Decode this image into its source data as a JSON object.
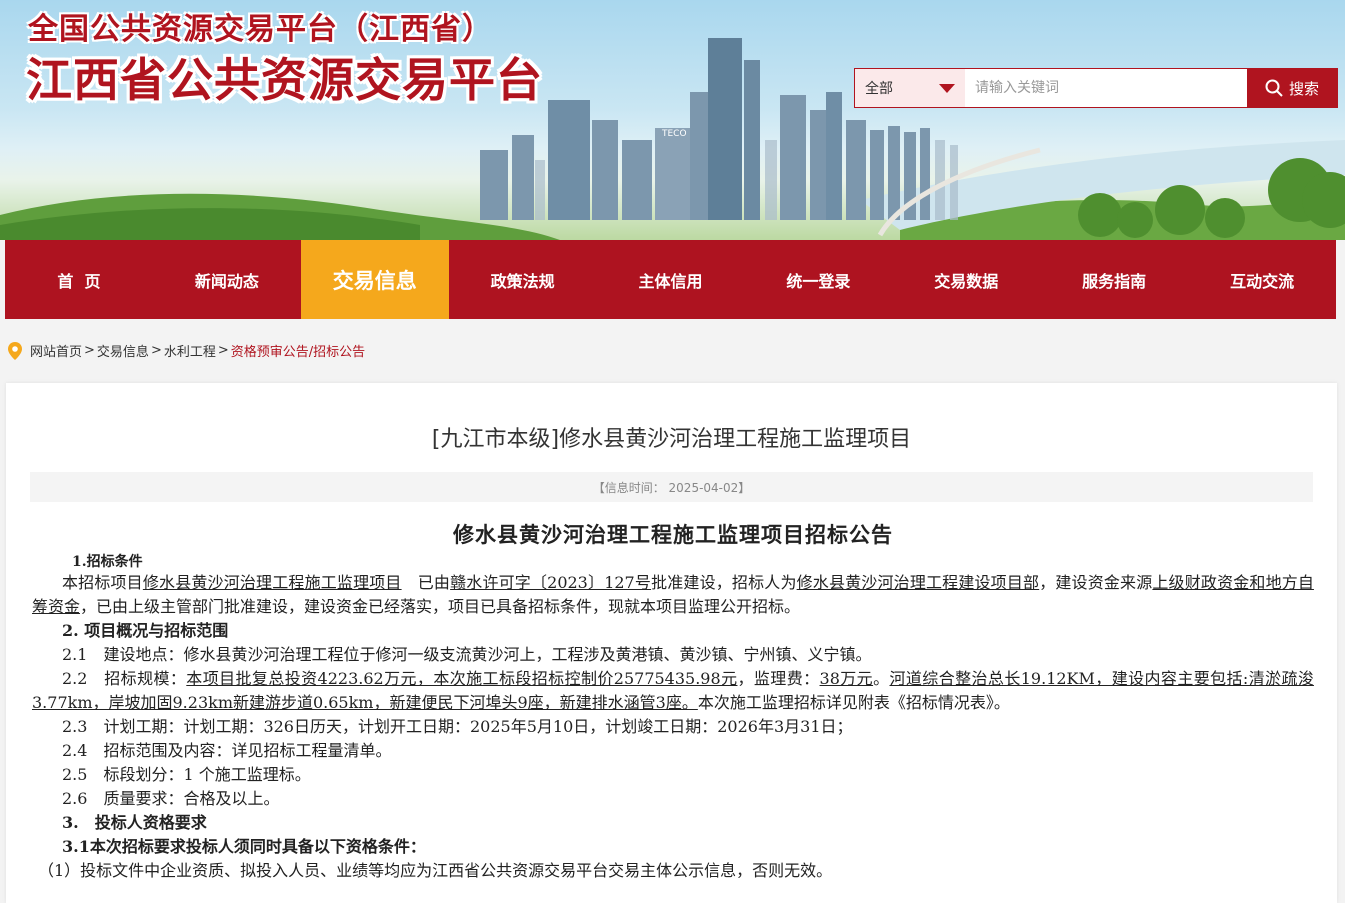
{
  "header": {
    "subtitle": "全国公共资源交易平台（江西省）",
    "title": "江西省公共资源交易平台"
  },
  "search": {
    "scope": "全部",
    "placeholder": "请输入关键词",
    "button": "搜索"
  },
  "nav": {
    "items": [
      "首  页",
      "新闻动态",
      "交易信息",
      "政策法规",
      "主体信用",
      "统一登录",
      "交易数据",
      "服务指南",
      "互动交流"
    ],
    "active_index": 2
  },
  "breadcrumb": {
    "items": [
      "网站首页",
      "交易信息",
      "水利工程",
      "资格预审公告/招标公告"
    ],
    "separators": [
      ">",
      ">",
      ">"
    ]
  },
  "article": {
    "title": "[九江市本级]修水县黄沙河治理工程施工监理项目",
    "info": "【信息时间：  2025-04-02】",
    "doc_title": "修水县黄沙河治理工程施工监理项目招标公告",
    "s1_heading": "1.招标条件",
    "s1_a": "本招标项目",
    "s1_project": "修水县黄沙河治理工程施工监理项目",
    "s1_b": "　已由",
    "s1_approval": "赣水许可字〔2023〕127号",
    "s1_c": "批准建设，招标人为",
    "s1_owner": "修水县黄沙河治理工程建设项目部",
    "s1_d": "，建设资金来源",
    "s1_funds": "上级财政资金和地方自筹资金",
    "s1_e": "，已由上级主管部门批准建设，建设资金已经落实，项目已具备招标条件，现就本项目监理公开招标。",
    "s2_heading": "2. 项目概况与招标范围",
    "s2_1": "2.1　建设地点：修水县黄沙河治理工程位于修河一级支流黄沙河上，工程涉及黄港镇、黄沙镇、宁州镇、义宁镇。",
    "s2_2_a": "2.2　招标规模：",
    "s2_2_scale": "本项目批复总投资4223.62万元，本次施工标段招标控制价25775435.98元",
    "s2_2_b": "，监理费：",
    "s2_2_fee": "38万元",
    "s2_2_c": "。",
    "s2_2_content": "河道综合整治总长19.12KM，建设内容主要包括:清淤疏浚3.77km，岸坡加固9.23km新建游步道0.65km，新建便民下河埠头9座，新建排水涵管3座。",
    "s2_2_d": "本次施工监理招标详见附表《招标情况表》。",
    "s2_3": "2.3　计划工期：计划工期：326日历天，计划开工日期：2025年5月10日，计划竣工日期：2026年3月31日；",
    "s2_4": "2.4　招标范围及内容：详见招标工程量清单。",
    "s2_5": "2.5　标段划分：1 个施工监理标。",
    "s2_6": "2.6　质量要求：合格及以上。",
    "s3_heading": "3.　投标人资格要求",
    "s3_1_heading": "3.1本次招标要求投标人须同时具备以下资格条件：",
    "s3_1_1": "（1）投标文件中企业资质、拟投入人员、业绩等均应为江西省公共资源交易平台交易主体公示信息，否则无效。"
  },
  "colors": {
    "brand_red": "#b0141f",
    "nav_active": "#f5a81c"
  },
  "icons": {
    "search": "search-icon",
    "location": "location-pin-icon",
    "dropdown": "dropdown-triangle-icon"
  }
}
